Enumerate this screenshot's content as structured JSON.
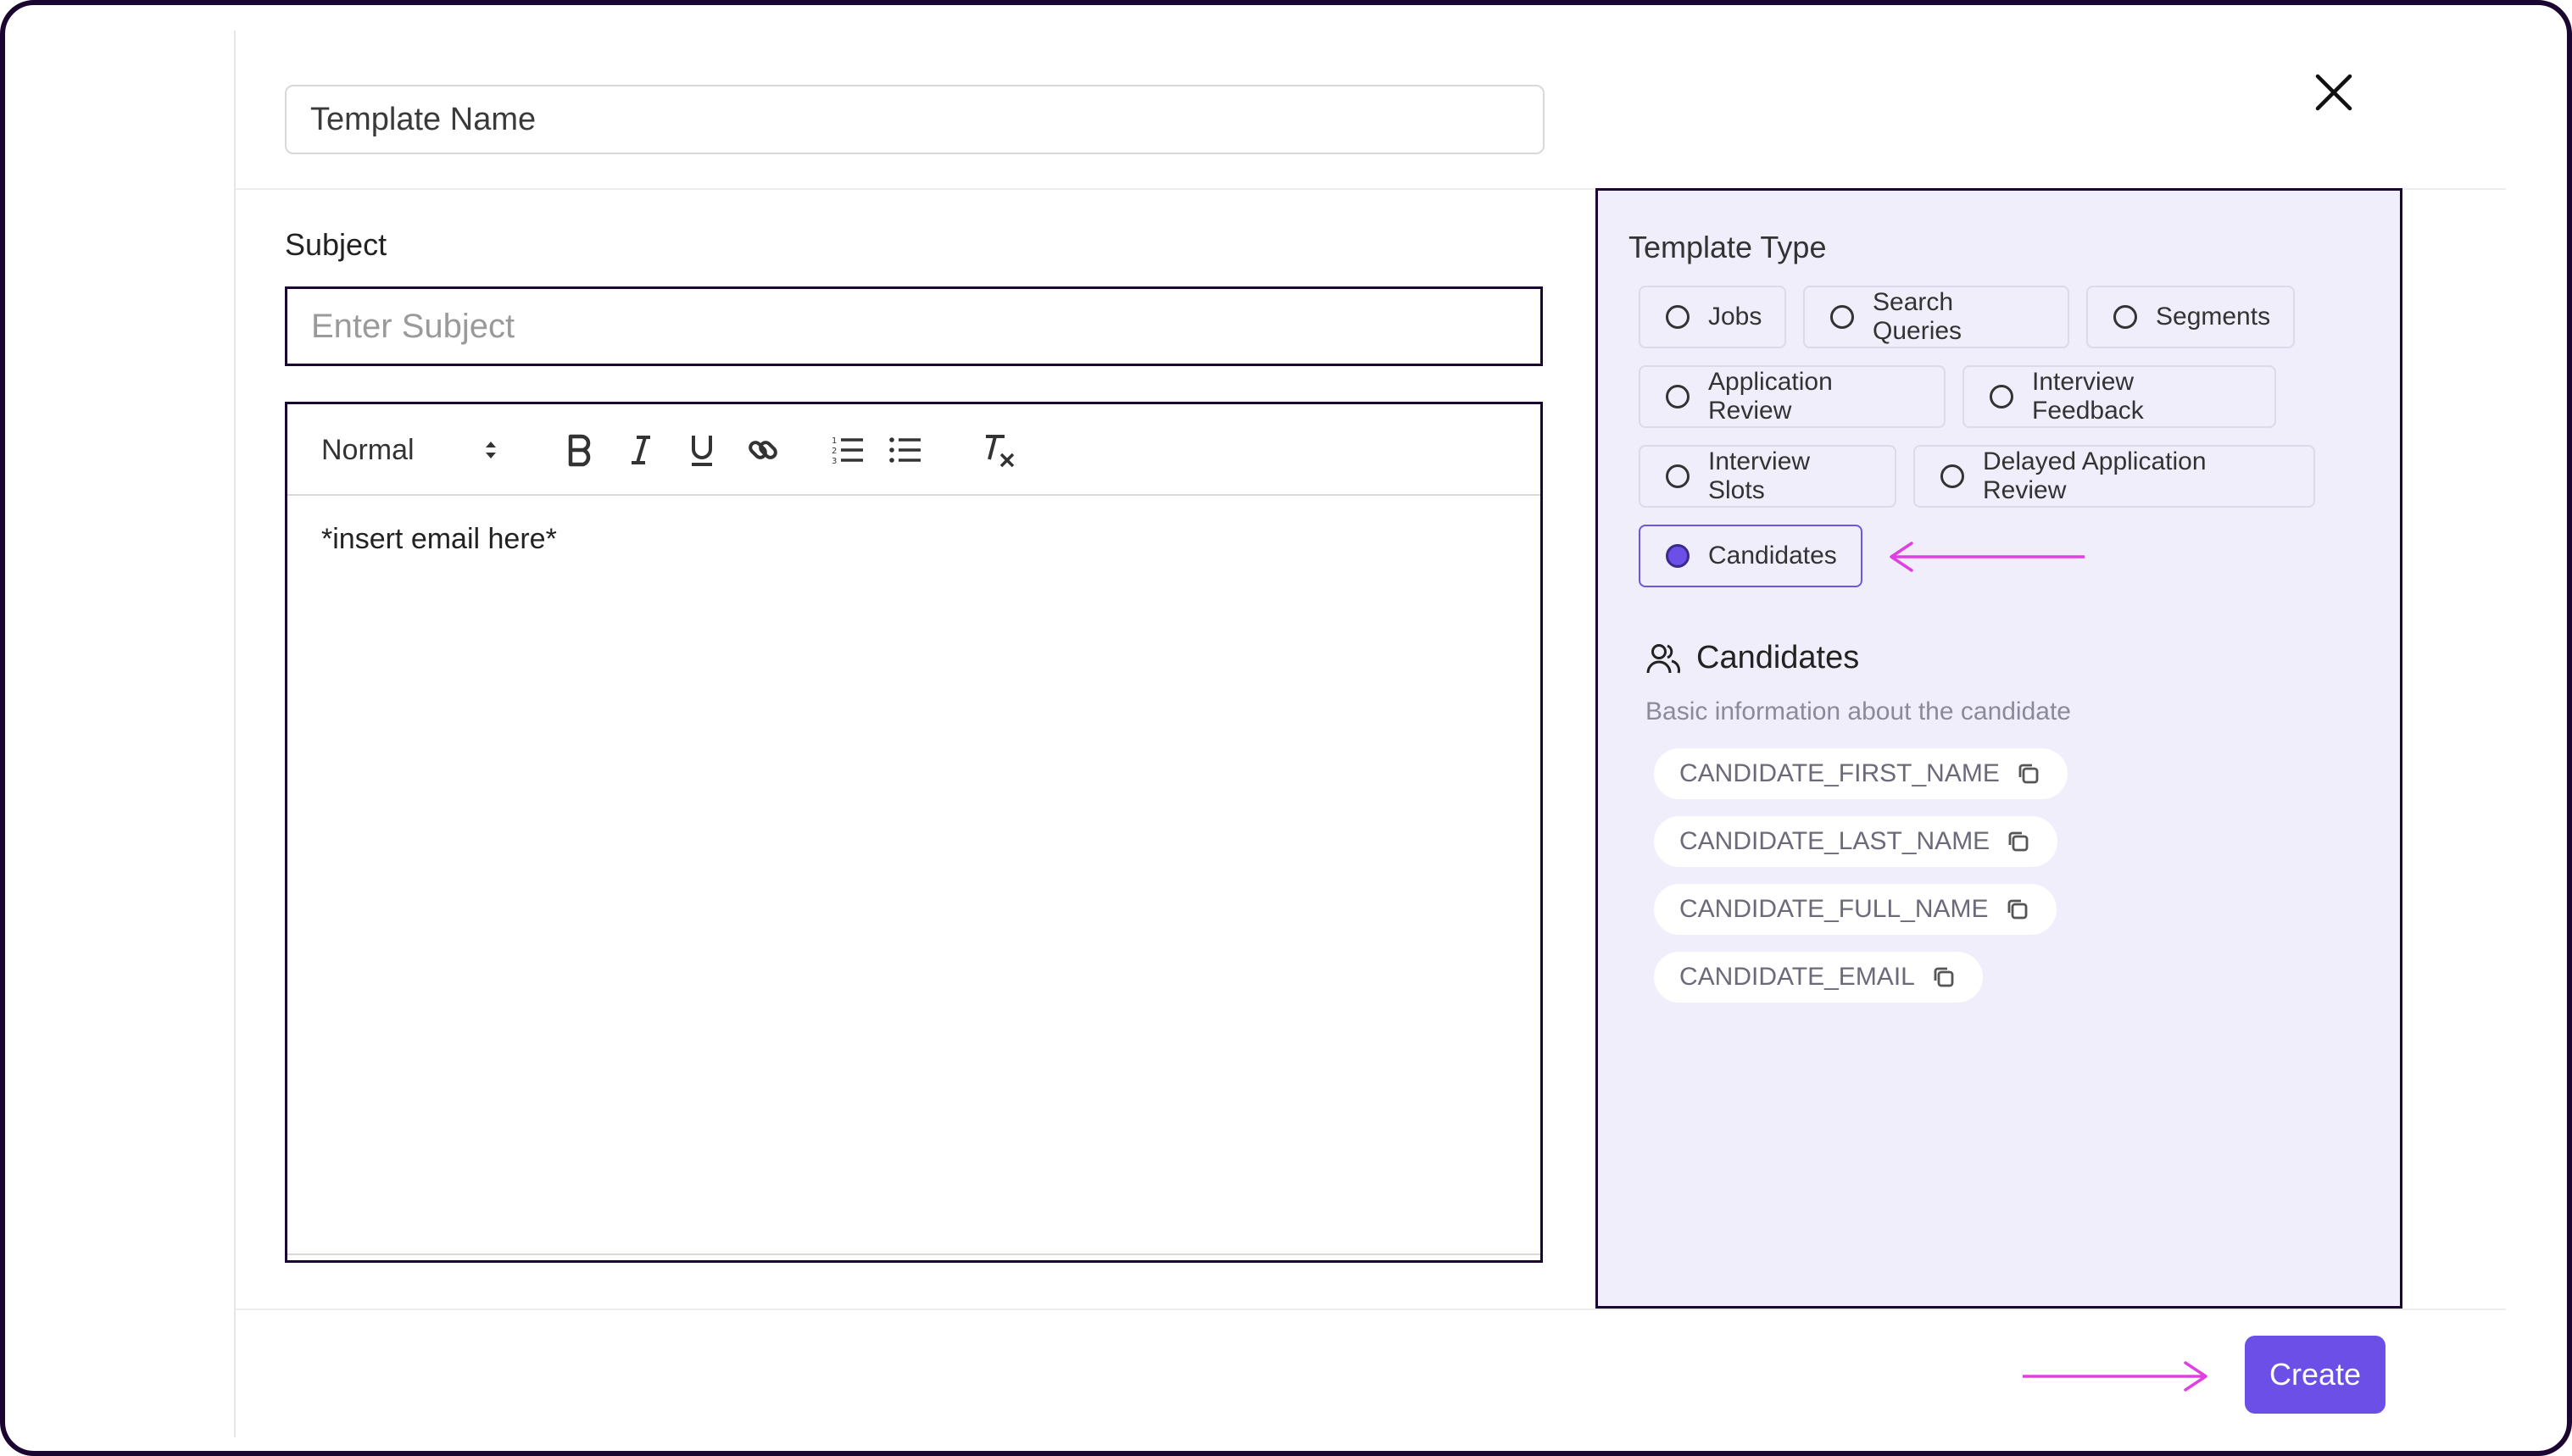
{
  "template_name": {
    "value": "Template Name"
  },
  "subject": {
    "label": "Subject",
    "placeholder": "Enter Subject"
  },
  "editor": {
    "format": "Normal",
    "body": "*insert email here*",
    "toolbar_icons": [
      "format-select-icon",
      "bold-icon",
      "italic-icon",
      "underline-icon",
      "link-icon",
      "ordered-list-icon",
      "bullet-list-icon",
      "clear-format-icon"
    ]
  },
  "template_type": {
    "label": "Template Type",
    "options": [
      {
        "label": "Jobs",
        "selected": false
      },
      {
        "label": "Search Queries",
        "selected": false
      },
      {
        "label": "Segments",
        "selected": false
      },
      {
        "label": "Application Review",
        "selected": false
      },
      {
        "label": "Interview Feedback",
        "selected": false
      },
      {
        "label": "Interview Slots",
        "selected": false
      },
      {
        "label": "Delayed Application Review",
        "selected": false
      },
      {
        "label": "Candidates",
        "selected": true
      }
    ]
  },
  "variables": {
    "title": "Candidates",
    "description": "Basic information about the candidate",
    "items": [
      "CANDIDATE_FIRST_NAME",
      "CANDIDATE_LAST_NAME",
      "CANDIDATE_FULL_NAME",
      "CANDIDATE_EMAIL"
    ]
  },
  "actions": {
    "create_label": "Create"
  },
  "colors": {
    "accent": "#6b4fe6",
    "panel_bg": "#f0eefb",
    "annotation_arrow": "#e040e0",
    "frame": "#1a0630"
  }
}
